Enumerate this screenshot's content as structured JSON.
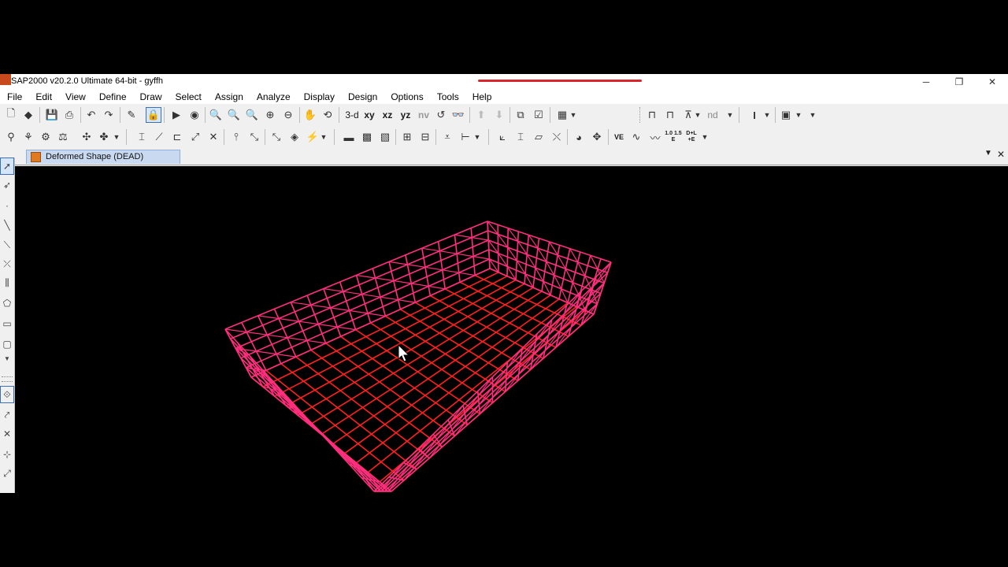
{
  "window": {
    "title": "SAP2000 v20.2.0 Ultimate 64-bit - gyffh",
    "controls": {
      "minimize": "─",
      "restore": "❐",
      "close": "✕"
    }
  },
  "menubar": {
    "items": [
      "File",
      "Edit",
      "View",
      "Define",
      "Draw",
      "Select",
      "Assign",
      "Analyze",
      "Display",
      "Design",
      "Options",
      "Tools",
      "Help"
    ]
  },
  "toolbar1": {
    "view_3d": "3-d",
    "view_xy": "xy",
    "view_xz": "xz",
    "view_yz": "yz",
    "view_nv": "nv",
    "nd": "nd"
  },
  "toolbar2": {
    "ve": "VE",
    "scale_label": "1.0 1.5 E",
    "dl_label": "D+L +E"
  },
  "tab": {
    "label": "Deformed Shape (DEAD)",
    "dropdown": "▼",
    "close": "✕"
  },
  "colors": {
    "accent_red": "#d9262c",
    "wall_mesh": "#ff2f7d",
    "floor_mesh": "#ff2020",
    "tab_active": "#c9daf0"
  }
}
